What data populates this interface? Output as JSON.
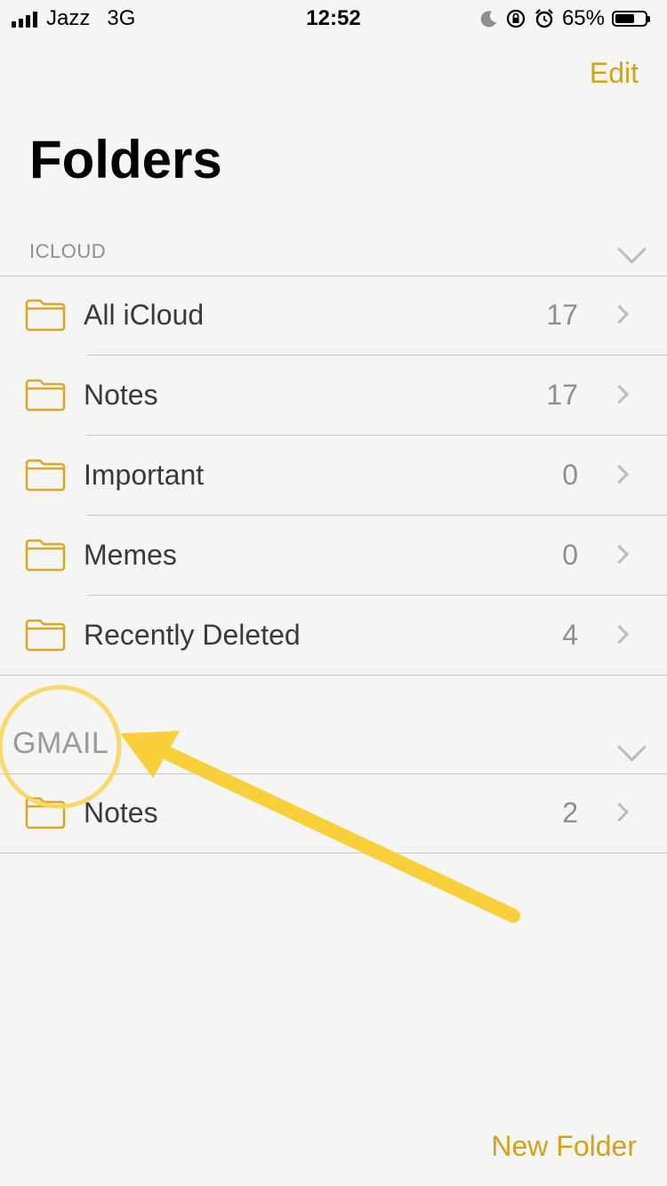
{
  "status_bar": {
    "carrier": "Jazz",
    "network": "3G",
    "time": "12:52",
    "battery_percent": "65%",
    "battery_level": 0.65,
    "icons": [
      "signal-icon",
      "moon-icon",
      "rotation-lock-icon",
      "alarm-icon",
      "battery-icon"
    ]
  },
  "header": {
    "edit_label": "Edit",
    "title": "Folders"
  },
  "sections": [
    {
      "label": "ICLOUD",
      "rows": [
        {
          "label": "All iCloud",
          "count": "17"
        },
        {
          "label": "Notes",
          "count": "17"
        },
        {
          "label": "Important",
          "count": "0"
        },
        {
          "label": "Memes",
          "count": "0"
        },
        {
          "label": "Recently Deleted",
          "count": "4"
        }
      ]
    },
    {
      "label": "GMAIL",
      "rows": [
        {
          "label": "Notes",
          "count": "2"
        }
      ]
    }
  ],
  "footer": {
    "new_folder_label": "New Folder"
  },
  "colors": {
    "accent": "#d4a119",
    "annotation": "#f9cf3a"
  }
}
